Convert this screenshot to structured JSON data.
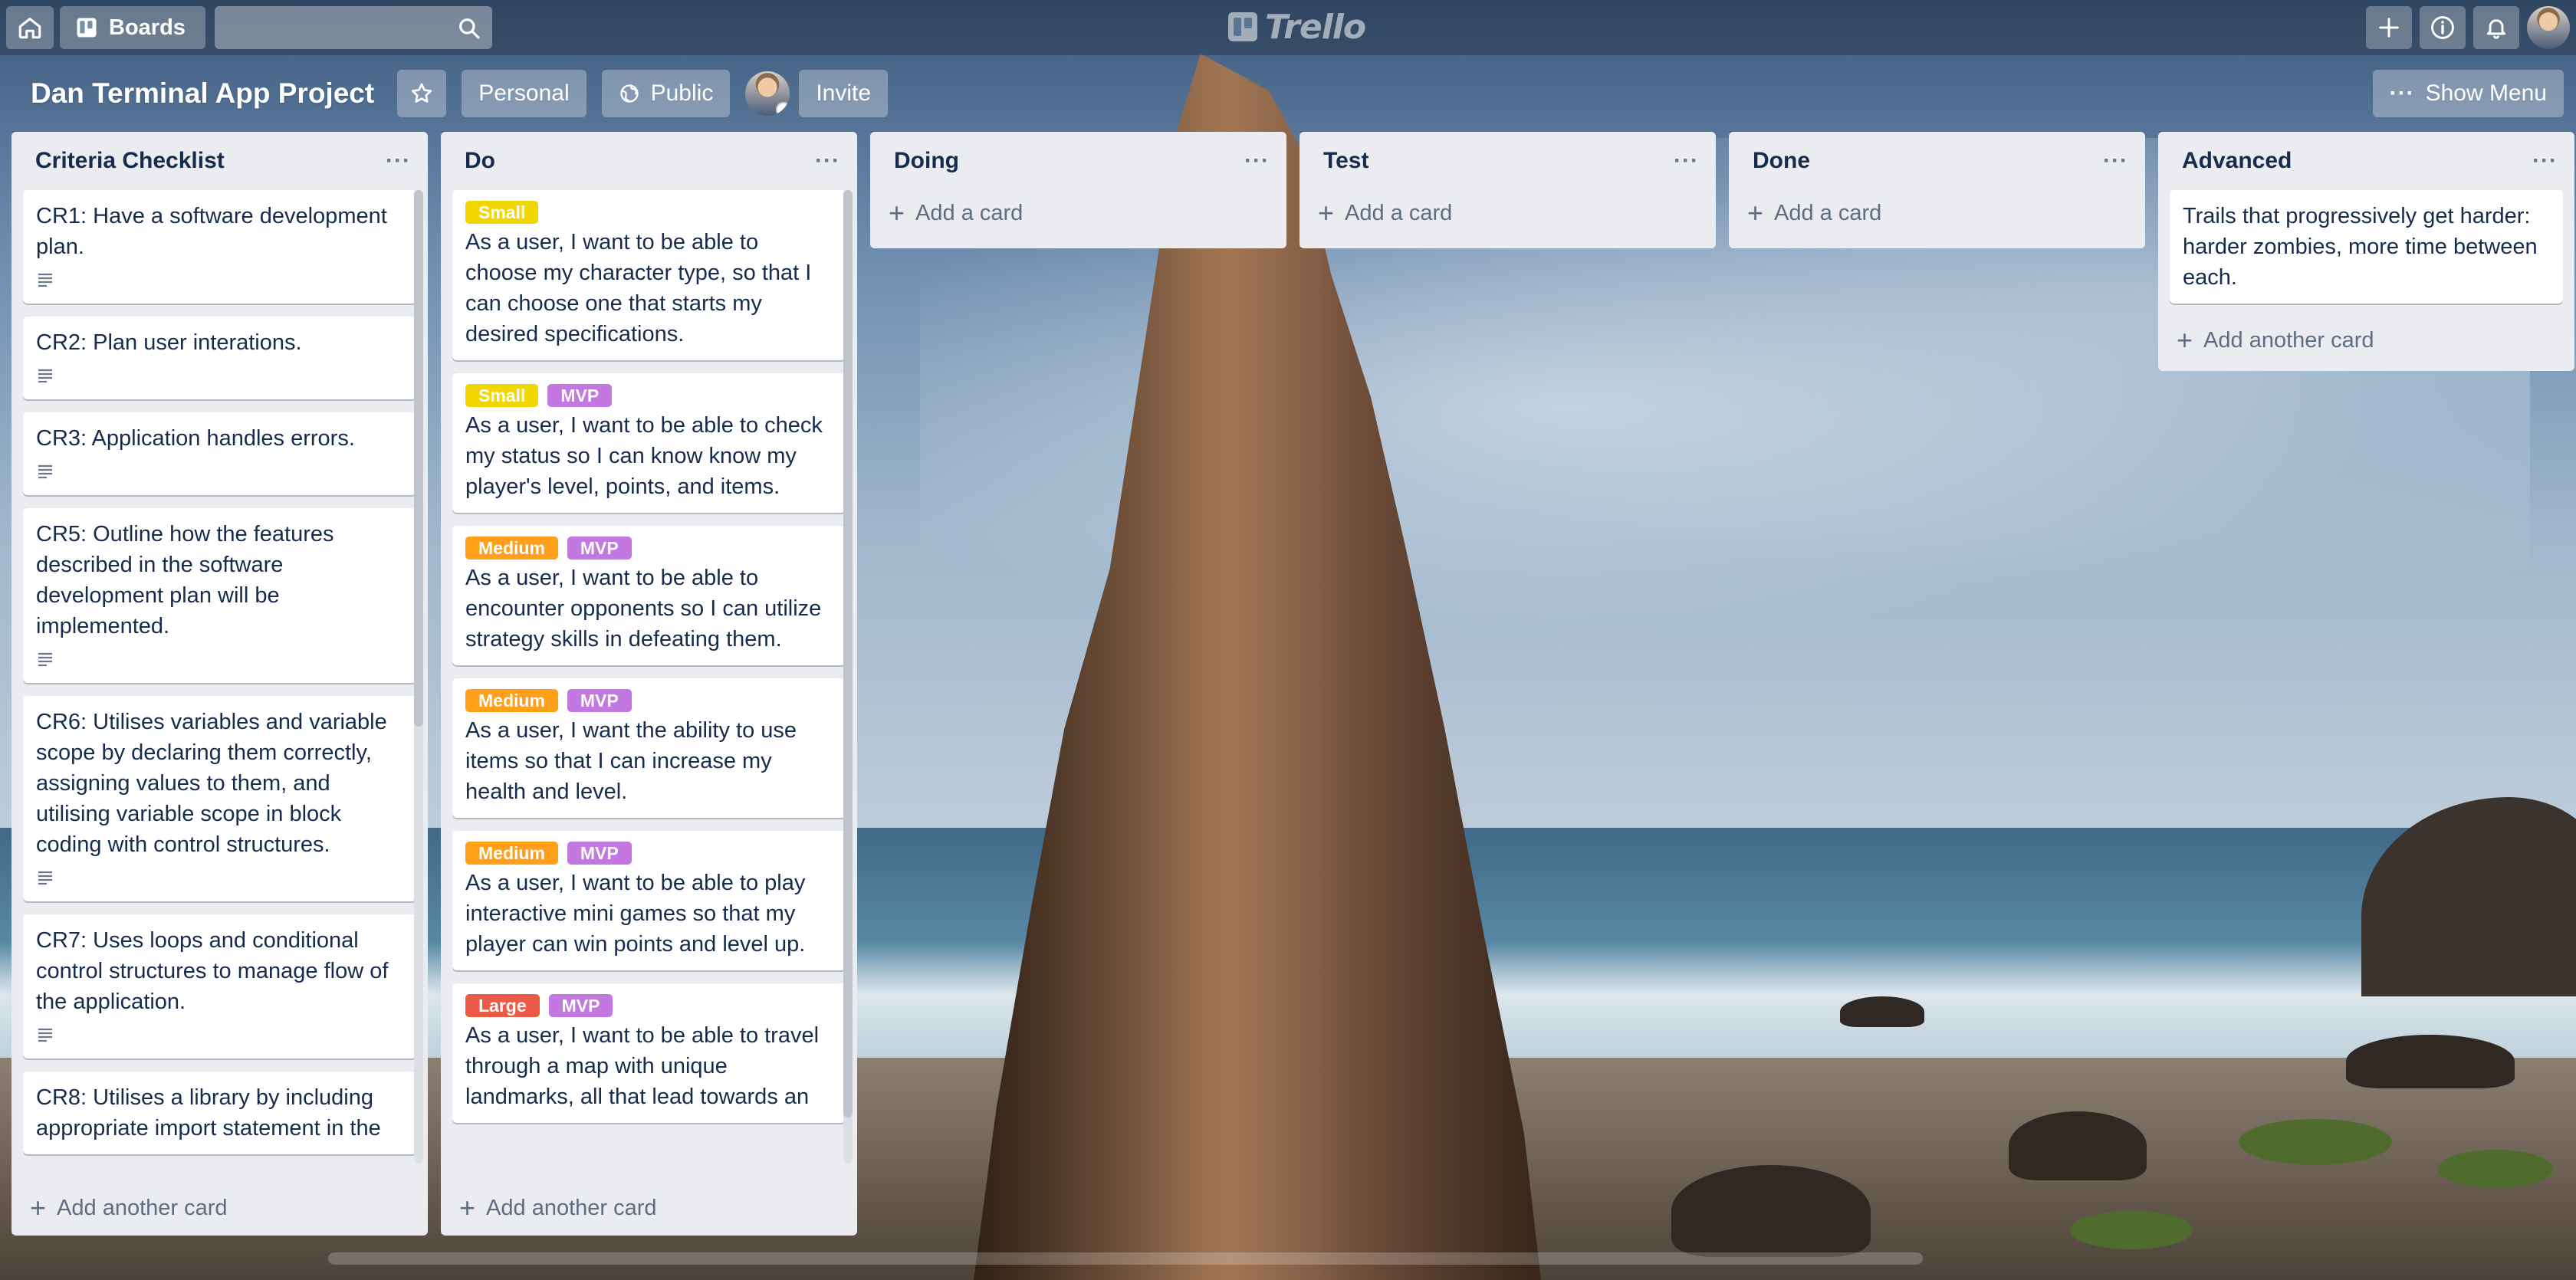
{
  "nav": {
    "boards_label": "Boards",
    "search_placeholder": "",
    "logo_text": "Trello"
  },
  "board": {
    "title": "Dan Terminal App Project",
    "team_label": "Personal",
    "visibility_label": "Public",
    "invite_label": "Invite",
    "show_menu_label": "Show Menu"
  },
  "lists": [
    {
      "title": "Criteria Checklist",
      "add_label": "Add another card",
      "cards": [
        {
          "text": "CR1: Have a software development plan."
        },
        {
          "text": "CR2: Plan user interations."
        },
        {
          "text": "CR3: Application handles errors."
        },
        {
          "text": "CR5: Outline how the features described in the software development plan will be implemented."
        },
        {
          "text": "CR6: Utilises variables and variable scope by declaring them correctly, assigning values to them, and utilising variable scope in block coding with control structures."
        },
        {
          "text": "CR7: Uses loops and conditional control structures to manage flow of the application."
        },
        {
          "text": "CR8: Utilises a library by including appropriate import statement in the"
        }
      ]
    },
    {
      "title": "Do",
      "add_label": "Add another card",
      "cards": [
        {
          "labels": [
            "Small"
          ],
          "text": "As a user, I want to be able to choose my character type, so that I can choose one that starts my desired specifications."
        },
        {
          "labels": [
            "Small",
            "MVP"
          ],
          "text": "As a user, I want to be able to check my status so I can know know my player's level, points, and items."
        },
        {
          "labels": [
            "Medium",
            "MVP"
          ],
          "text": "As a user, I want to be able to encounter opponents so I can utilize strategy skills in defeating them."
        },
        {
          "labels": [
            "Medium",
            "MVP"
          ],
          "text": "As a user, I want the ability to use items so that I can increase my health and level."
        },
        {
          "labels": [
            "Medium",
            "MVP"
          ],
          "text": "As a user, I want to be able to play interactive mini games so that my player can win points and level up."
        },
        {
          "labels": [
            "Large",
            "MVP"
          ],
          "text": "As a user, I want to be able to travel through a map with unique landmarks, all that lead towards an"
        }
      ]
    },
    {
      "title": "Doing",
      "add_label": "Add a card"
    },
    {
      "title": "Test",
      "add_label": "Add a card"
    },
    {
      "title": "Done",
      "add_label": "Add a card"
    },
    {
      "title": "Advanced",
      "add_label": "Add another card",
      "cards": [
        {
          "text": "Trails that progressively get harder: harder zombies, more time between each."
        }
      ]
    }
  ],
  "colors": {
    "label_small": "#f2d600",
    "label_medium": "#ff9f1a",
    "label_large": "#eb5a46",
    "label_mvp": "#c377e0",
    "list_bg": "#ebecf0"
  }
}
